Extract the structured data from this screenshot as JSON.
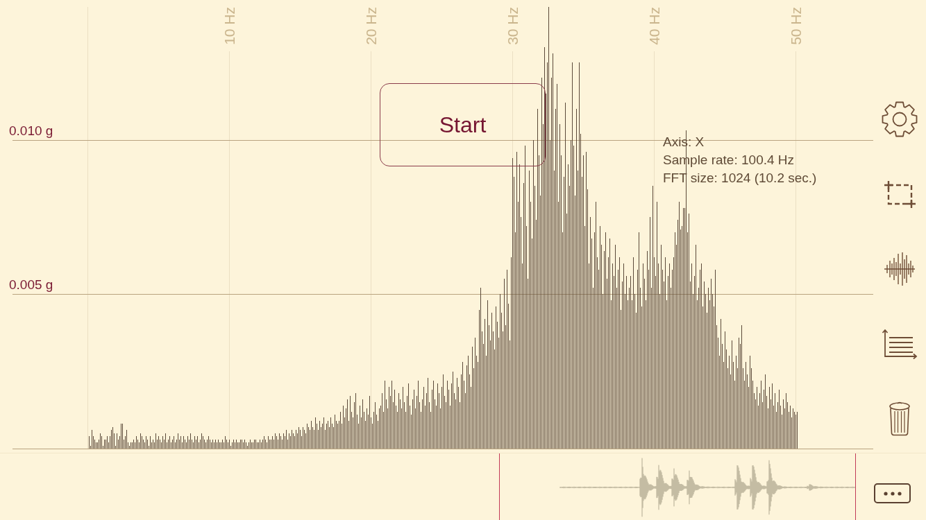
{
  "spectrum": {
    "chart_data": {
      "type": "bar",
      "xlim": [
        -5.292,
        59.194
      ],
      "ylim": [
        0,
        0.0143
      ],
      "grid": true,
      "xticks": [
        {
          "value": 10,
          "label": "10 Hz"
        },
        {
          "value": 20,
          "label": "20 Hz"
        },
        {
          "value": 30,
          "label": "30 Hz"
        },
        {
          "value": 40,
          "label": "40 Hz"
        },
        {
          "value": 50,
          "label": "50 Hz"
        }
      ],
      "yticks": [
        {
          "value": 0.005,
          "label": "0.005 g"
        },
        {
          "value": 0.01,
          "label": "0.010 g"
        }
      ],
      "x": [
        0.098,
        0.196,
        0.294,
        0.392,
        0.49,
        0.588,
        0.686,
        0.784,
        0.882,
        0.98,
        1.078,
        1.176,
        1.274,
        1.372,
        1.47,
        1.568,
        1.666,
        1.764,
        1.862,
        1.96,
        2.058,
        2.156,
        2.254,
        2.352,
        2.45,
        2.548,
        2.646,
        2.744,
        2.842,
        2.94,
        3.038,
        3.136,
        3.234,
        3.332,
        3.43,
        3.528,
        3.626,
        3.724,
        3.822,
        3.92,
        4.018,
        4.116,
        4.214,
        4.312,
        4.41,
        4.508,
        4.606,
        4.704,
        4.802,
        4.9,
        4.998,
        5.096,
        5.194,
        5.292,
        5.39,
        5.488,
        5.586,
        5.684,
        5.782,
        5.88,
        5.978,
        6.076,
        6.174,
        6.272,
        6.37,
        6.468,
        6.566,
        6.664,
        6.762,
        6.86,
        6.958,
        7.056,
        7.154,
        7.252,
        7.35,
        7.448,
        7.546,
        7.644,
        7.742,
        7.84,
        7.938,
        8.036,
        8.134,
        8.232,
        8.33,
        8.428,
        8.526,
        8.624,
        8.722,
        8.82,
        8.918,
        9.016,
        9.114,
        9.212,
        9.31,
        9.408,
        9.506,
        9.604,
        9.702,
        9.8,
        9.898,
        9.996,
        10.094,
        10.192,
        10.29,
        10.388,
        10.486,
        10.584,
        10.682,
        10.78,
        10.878,
        10.976,
        11.074,
        11.172,
        11.27,
        11.368,
        11.466,
        11.564,
        11.662,
        11.76,
        11.858,
        11.956,
        12.054,
        12.152,
        12.25,
        12.348,
        12.446,
        12.544,
        12.642,
        12.74,
        12.838,
        12.936,
        13.034,
        13.132,
        13.23,
        13.328,
        13.426,
        13.524,
        13.622,
        13.72,
        13.818,
        13.916,
        14.014,
        14.112,
        14.21,
        14.308,
        14.406,
        14.504,
        14.602,
        14.7,
        14.798,
        14.896,
        14.994,
        15.092,
        15.19,
        15.288,
        15.386,
        15.484,
        15.582,
        15.68,
        15.778,
        15.876,
        15.974,
        16.072,
        16.17,
        16.268,
        16.366,
        16.464,
        16.562,
        16.66,
        16.758,
        16.856,
        16.954,
        17.052,
        17.15,
        17.248,
        17.346,
        17.444,
        17.542,
        17.64,
        17.738,
        17.836,
        17.934,
        18.032,
        18.13,
        18.228,
        18.326,
        18.424,
        18.522,
        18.62,
        18.718,
        18.816,
        18.914,
        19.012,
        19.11,
        19.208,
        19.306,
        19.404,
        19.502,
        19.6,
        19.698,
        19.796,
        19.894,
        19.992,
        20.09,
        20.188,
        20.286,
        20.384,
        20.482,
        20.58,
        20.678,
        20.776,
        20.874,
        20.972,
        21.07,
        21.168,
        21.266,
        21.364,
        21.462,
        21.56,
        21.658,
        21.756,
        21.854,
        21.952,
        22.05,
        22.148,
        22.246,
        22.344,
        22.442,
        22.54,
        22.638,
        22.736,
        22.834,
        22.932,
        23.03,
        23.128,
        23.226,
        23.324,
        23.422,
        23.52,
        23.618,
        23.716,
        23.814,
        23.912,
        24.01,
        24.108,
        24.206,
        24.304,
        24.402,
        24.5,
        24.598,
        24.696,
        24.794,
        24.892,
        24.99,
        25.088,
        25.186,
        25.284,
        25.382,
        25.48,
        25.578,
        25.676,
        25.774,
        25.872,
        25.97,
        26.068,
        26.166,
        26.264,
        26.362,
        26.46,
        26.558,
        26.656,
        26.754,
        26.852,
        26.95,
        27.048,
        27.146,
        27.244,
        27.342,
        27.44,
        27.538,
        27.636,
        27.734,
        27.832,
        27.93,
        28.028,
        28.126,
        28.224,
        28.322,
        28.42,
        28.518,
        28.616,
        28.714,
        28.812,
        28.91,
        29.008,
        29.106,
        29.204,
        29.302,
        29.4,
        29.498,
        29.596,
        29.694,
        29.792,
        29.89,
        29.988,
        30.086,
        30.184,
        30.282,
        30.38,
        30.478,
        30.576,
        30.674,
        30.772,
        30.87,
        30.968,
        31.066,
        31.164,
        31.262,
        31.36,
        31.458,
        31.556,
        31.654,
        31.752,
        31.85,
        31.948,
        32.046,
        32.144,
        32.242,
        32.34,
        32.438,
        32.536,
        32.634,
        32.732,
        32.83,
        32.928,
        33.026,
        33.124,
        33.222,
        33.32,
        33.418,
        33.516,
        33.614,
        33.712,
        33.81,
        33.908,
        34.006,
        34.104,
        34.202,
        34.3,
        34.398,
        34.496,
        34.594,
        34.692,
        34.79,
        34.888,
        34.986,
        35.084,
        35.182,
        35.28,
        35.378,
        35.476,
        35.574,
        35.672,
        35.77,
        35.868,
        35.966,
        36.064,
        36.162,
        36.26,
        36.358,
        36.456,
        36.554,
        36.652,
        36.75,
        36.848,
        36.946,
        37.044,
        37.142,
        37.24,
        37.338,
        37.436,
        37.534,
        37.632,
        37.73,
        37.828,
        37.926,
        38.024,
        38.122,
        38.22,
        38.318,
        38.416,
        38.514,
        38.612,
        38.71,
        38.808,
        38.906,
        39.004,
        39.102,
        39.2,
        39.298,
        39.396,
        39.494,
        39.592,
        39.69,
        39.788,
        39.886,
        39.984,
        40.082,
        40.18,
        40.278,
        40.376,
        40.474,
        40.572,
        40.67,
        40.768,
        40.866,
        40.964,
        41.062,
        41.16,
        41.258,
        41.356,
        41.454,
        41.552,
        41.65,
        41.748,
        41.846,
        41.944,
        42.042,
        42.14,
        42.238,
        42.336,
        42.434,
        42.532,
        42.63,
        42.728,
        42.826,
        42.924,
        43.022,
        43.12,
        43.218,
        43.316,
        43.414,
        43.512,
        43.61,
        43.708,
        43.806,
        43.904,
        44.002,
        44.1,
        44.198,
        44.296,
        44.394,
        44.492,
        44.59,
        44.688,
        44.786,
        44.884,
        44.982,
        45.08,
        45.178,
        45.276,
        45.374,
        45.472,
        45.57,
        45.668,
        45.766,
        45.864,
        45.962,
        46.06,
        46.158,
        46.256,
        46.354,
        46.452,
        46.55,
        46.648,
        46.746,
        46.844,
        46.942,
        47.04,
        47.138,
        47.236,
        47.334,
        47.432,
        47.53,
        47.628,
        47.726,
        47.824,
        47.922,
        48.02,
        48.118,
        48.216,
        48.314,
        48.412,
        48.51,
        48.608,
        48.706,
        48.804,
        48.902,
        49,
        49.098,
        49.196,
        49.294,
        49.392,
        49.49,
        49.588,
        49.686,
        49.784,
        49.882,
        49.98,
        50.078
      ],
      "values": [
        0.0004,
        0.0001,
        0.0006,
        0.0004,
        0.0003,
        0.0002,
        0.0002,
        0.0003,
        0.0005,
        0.0004,
        0.0001,
        0.0003,
        0.0003,
        0.0004,
        0.0002,
        0.0004,
        0.0006,
        0.0007,
        0.0005,
        0.0001,
        0.0005,
        0.0003,
        0.0004,
        0.0008,
        0.0008,
        0.0003,
        0.0004,
        0.0006,
        0.0002,
        0.0001,
        0.0002,
        0.0002,
        0.0003,
        0.0002,
        0.0004,
        0.0003,
        0.0002,
        0.0005,
        0.0004,
        0.0003,
        0.0002,
        0.0004,
        0.0003,
        0.0001,
        0.0004,
        0.0002,
        0.0003,
        0.0002,
        0.0005,
        0.0003,
        0.0004,
        0.0003,
        0.0002,
        0.0004,
        0.0003,
        0.0005,
        0.0002,
        0.0003,
        0.0004,
        0.0002,
        0.0003,
        0.0004,
        0.0002,
        0.0003,
        0.0005,
        0.0003,
        0.0004,
        0.0002,
        0.0004,
        0.0003,
        0.0002,
        0.0004,
        0.0003,
        0.0005,
        0.0003,
        0.0002,
        0.0004,
        0.0003,
        0.0004,
        0.0002,
        0.0003,
        0.0005,
        0.0004,
        0.0003,
        0.0002,
        0.0003,
        0.0004,
        0.0003,
        0.0002,
        0.0003,
        0.0002,
        0.0003,
        0.0002,
        0.0003,
        0.0002,
        0.0002,
        0.0003,
        0.0002,
        0.0004,
        0.0003,
        0.0002,
        0.0003,
        0.0001,
        0.0002,
        0.0003,
        0.0002,
        0.0003,
        0.0002,
        0.0002,
        0.0003,
        0.0003,
        0.0002,
        0.0003,
        0.0002,
        0.0001,
        0.0002,
        0.0003,
        0.0002,
        0.0002,
        0.0003,
        0.0003,
        0.0002,
        0.0002,
        0.0003,
        0.0002,
        0.0003,
        0.0004,
        0.0003,
        0.0002,
        0.0004,
        0.0003,
        0.0003,
        0.0004,
        0.0003,
        0.0005,
        0.0004,
        0.0003,
        0.0005,
        0.0004,
        0.0003,
        0.0005,
        0.0004,
        0.0006,
        0.0003,
        0.0005,
        0.0004,
        0.0006,
        0.0005,
        0.0004,
        0.0006,
        0.0005,
        0.0007,
        0.0006,
        0.0004,
        0.0007,
        0.0006,
        0.0005,
        0.0008,
        0.0007,
        0.0006,
        0.0009,
        0.0007,
        0.0006,
        0.001,
        0.0008,
        0.0006,
        0.0009,
        0.0007,
        0.0008,
        0.001,
        0.0006,
        0.0008,
        0.0009,
        0.0007,
        0.001,
        0.0008,
        0.0007,
        0.0011,
        0.0009,
        0.0008,
        0.0009,
        0.0012,
        0.0008,
        0.0014,
        0.001,
        0.0013,
        0.0016,
        0.0009,
        0.0017,
        0.0012,
        0.001,
        0.0015,
        0.0018,
        0.0011,
        0.0008,
        0.0014,
        0.001,
        0.0016,
        0.0012,
        0.0009,
        0.0013,
        0.0011,
        0.0017,
        0.001,
        0.0008,
        0.0012,
        0.0015,
        0.0011,
        0.0009,
        0.0013,
        0.0014,
        0.0018,
        0.0012,
        0.0022,
        0.0016,
        0.0013,
        0.002,
        0.0017,
        0.0022,
        0.0015,
        0.0019,
        0.0014,
        0.0012,
        0.0018,
        0.0016,
        0.0013,
        0.002,
        0.0015,
        0.0012,
        0.0017,
        0.0021,
        0.0014,
        0.0011,
        0.0016,
        0.0019,
        0.0013,
        0.0017,
        0.0022,
        0.0015,
        0.0012,
        0.0016,
        0.002,
        0.0014,
        0.0018,
        0.0023,
        0.0015,
        0.0012,
        0.0019,
        0.0022,
        0.0016,
        0.0014,
        0.0021,
        0.0018,
        0.0013,
        0.002,
        0.0024,
        0.0017,
        0.0015,
        0.0022,
        0.0019,
        0.0014,
        0.0021,
        0.0025,
        0.0018,
        0.0016,
        0.0023,
        0.002,
        0.0015,
        0.0024,
        0.0028,
        0.0022,
        0.0018,
        0.0027,
        0.003,
        0.0024,
        0.002,
        0.0033,
        0.0026,
        0.0036,
        0.003,
        0.0028,
        0.0045,
        0.0052,
        0.0038,
        0.0034,
        0.0042,
        0.003,
        0.0048,
        0.004,
        0.0035,
        0.0044,
        0.0038,
        0.0032,
        0.0046,
        0.0041,
        0.0036,
        0.005,
        0.0044,
        0.0038,
        0.0055,
        0.004,
        0.0058,
        0.0047,
        0.0035,
        0.0062,
        0.0094,
        0.0088,
        0.007,
        0.0096,
        0.008,
        0.0092,
        0.0075,
        0.006,
        0.0086,
        0.0098,
        0.0072,
        0.0055,
        0.009,
        0.008,
        0.0068,
        0.01,
        0.0085,
        0.0074,
        0.011,
        0.0095,
        0.0082,
        0.012,
        0.0105,
        0.013,
        0.0115,
        0.0125,
        0.0143,
        0.01,
        0.012,
        0.0128,
        0.009,
        0.011,
        0.0118,
        0.008,
        0.0105,
        0.0095,
        0.007,
        0.0088,
        0.0112,
        0.0076,
        0.0092,
        0.0085,
        0.01,
        0.0125,
        0.0098,
        0.0082,
        0.011,
        0.009,
        0.0125,
        0.0102,
        0.0088,
        0.0095,
        0.0072,
        0.0096,
        0.0084,
        0.006,
        0.0075,
        0.0068,
        0.0052,
        0.007,
        0.008,
        0.0062,
        0.0058,
        0.0072,
        0.0066,
        0.005,
        0.0064,
        0.007,
        0.0055,
        0.0062,
        0.0068,
        0.0048,
        0.006,
        0.0056,
        0.0066,
        0.0052,
        0.0058,
        0.0062,
        0.0045,
        0.0054,
        0.006,
        0.005,
        0.0056,
        0.0048,
        0.0052,
        0.0056,
        0.0048,
        0.0062,
        0.005,
        0.0044,
        0.0058,
        0.007,
        0.0052,
        0.0046,
        0.006,
        0.0055,
        0.0048,
        0.0064,
        0.0058,
        0.0075,
        0.0052,
        0.0085,
        0.0062,
        0.0056,
        0.008,
        0.006,
        0.005,
        0.0066,
        0.0058,
        0.0054,
        0.0062,
        0.0048,
        0.0056,
        0.006,
        0.0052,
        0.0058,
        0.0062,
        0.007,
        0.0066,
        0.0074,
        0.008,
        0.0071,
        0.0072,
        0.0078,
        0.0078,
        0.0103,
        0.007,
        0.0076,
        0.0054,
        0.006,
        0.005,
        0.0056,
        0.0066,
        0.0048,
        0.0052,
        0.0058,
        0.006,
        0.0046,
        0.0054,
        0.005,
        0.0044,
        0.0052,
        0.0048,
        0.0055,
        0.005,
        0.0046,
        0.0058,
        0.004,
        0.0036,
        0.003,
        0.0042,
        0.0034,
        0.0028,
        0.0038,
        0.0032,
        0.0026,
        0.003,
        0.0024,
        0.0035,
        0.0028,
        0.0022,
        0.003,
        0.0026,
        0.0036,
        0.0034,
        0.004,
        0.0026,
        0.0022,
        0.0028,
        0.0024,
        0.002,
        0.003,
        0.0026,
        0.0022,
        0.0018,
        0.0016,
        0.002,
        0.0014,
        0.0018,
        0.0022,
        0.0015,
        0.0019,
        0.0024,
        0.0017,
        0.0013,
        0.002,
        0.0016,
        0.0021,
        0.0014,
        0.0018,
        0.0012,
        0.0015,
        0.0019,
        0.0014,
        0.0011,
        0.0016,
        0.0013,
        0.0018,
        0.0015,
        0.0012,
        0.0014,
        0.001,
        0.0013,
        0.0012,
        0.0011,
        0.0012
      ]
    }
  },
  "start_button": {
    "label": "Start"
  },
  "info": [
    "Axis: X",
    "Sample rate: 100.4 Hz",
    "FFT size: 1024 (10.2 sec.)"
  ]
}
